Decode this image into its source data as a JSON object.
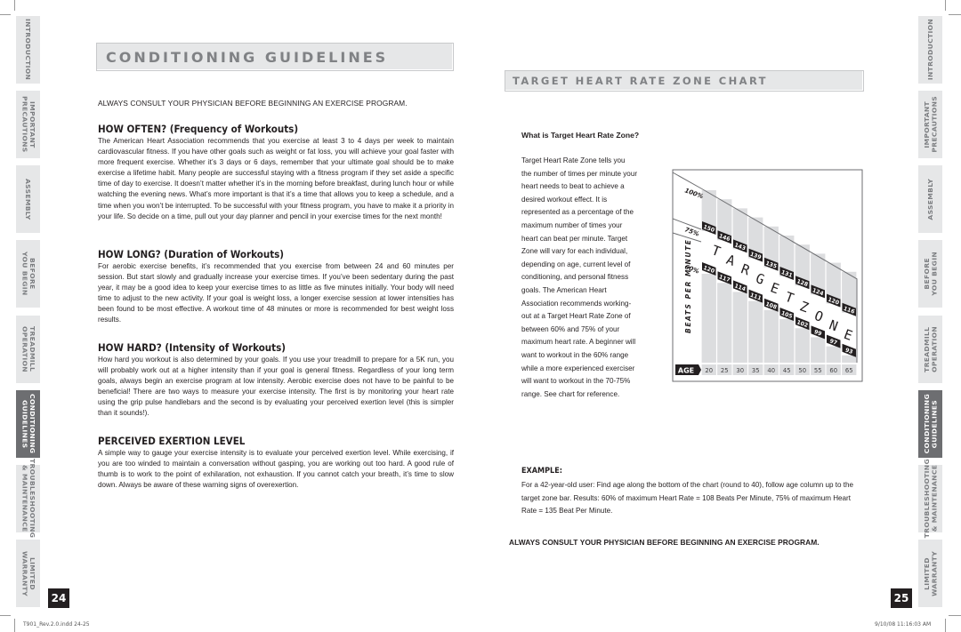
{
  "left_page": {
    "header": "CONDITIONING GUIDELINES",
    "consult_notice": "ALWAYS CONSULT YOUR PHYSICIAN BEFORE BEGINNING AN EXERCISE PROGRAM.",
    "sections": [
      {
        "title": "HOW OFTEN? (Frequency of Workouts)",
        "body": "The American Heart Association recommends that you exercise at least 3 to 4 days per week to maintain cardiovascular fitness. If you have other goals such as weight or fat loss, you will achieve your goal faster with more frequent exercise. Whether it’s 3 days or 6 days, remember that your ultimate goal should be to make exercise a lifetime habit. Many people are successful staying with a fitness program if they set aside a specific time of day to exercise. It doesn’t matter whether it’s in the morning before breakfast, during lunch hour or while watching the evening news. What’s more important is that it’s a time that allows you to keep a schedule, and a time when you won’t be interrupted. To be successful with your fitness program, you have to make it a priority in your life. So decide on a time, pull out your day planner and pencil in your exercise times for the next month!"
      },
      {
        "title": "HOW LONG? (Duration of Workouts)",
        "body": "For aerobic exercise benefits, it’s recommended that you exercise from between 24 and 60 minutes per session. But start slowly and gradually increase your exercise times. If you’ve been sedentary during the past year, it may be a good idea to keep your exercise times to as little as five minutes initially. Your body will need time to adjust to the new activity. If your goal is weight loss, a longer exercise session at lower intensities has been found to be most effective. A workout time of 48 minutes or more is recommended for best weight loss results."
      },
      {
        "title": "HOW HARD? (Intensity of Workouts)",
        "body": "How hard you workout is also determined by your goals. If you use your treadmill to prepare for a 5K run, you will probably work out at a higher intensity than if your goal is general fitness. Regardless of your long term goals, always begin an exercise program at low intensity. Aerobic exercise does not have to be painful to be beneficial! There are two ways to measure your exercise intensity. The first is by monitoring your heart rate using the grip pulse handlebars and the second is by evaluating your perceived exertion level (this is simpler than it sounds!)."
      },
      {
        "title": "PERCEIVED EXERTION LEVEL",
        "body": "A simple way to gauge your exercise intensity is to evaluate your perceived exertion level. While exercising, if you are too winded to maintain a conversation without gasping, you are working out too hard. A good rule of thumb is to work to the point of exhilaration, not exhaustion. If you cannot catch your breath, it’s time to slow down. Always be aware of these warning signs of overexertion."
      }
    ],
    "page_number": "24",
    "footer_note": "T901_Rev.2.0.indd   24-25"
  },
  "right_page": {
    "header": "TARGET HEART RATE ZONE CHART",
    "question": "What is Target Heart Rate Zone?",
    "intro": "Target Heart Rate Zone tells you the number of times per minute your heart needs to beat to achieve a desired workout effect. It is represented as a percentage of the maximum number of times your heart can beat per minute. Target Zone will vary for each individual, depending on age, current level of conditioning, and personal fitness goals. The American Heart Association recommends working-out at a Target Heart Rate Zone of between 60% and 75% of your maximum heart rate. A beginner will want to workout in the 60% range while a more experienced exerciser will want to workout in the 70-75% range. See chart for reference.",
    "example_title": "EXAMPLE:",
    "example_body": "For a 42-year-old user: Find age along the bottom of the chart (round to 40), follow age column up to the target zone bar. Results: 60% of maximum Heart Rate = 108 Beats Per Minute, 75% of maximum Heart Rate = 135 Beat Per Minute.",
    "consult_notice": "ALWAYS CONSULT YOUR PHYSICIAN BEFORE BEGINNING AN EXERCISE PROGRAM.",
    "page_number": "25",
    "footer_note": "9/10/08   11:16:03 AM"
  },
  "side_tabs": [
    {
      "label": "INTRODUCTION",
      "active": false
    },
    {
      "label": "IMPORTANT\nPRECAUTIONS",
      "active": false
    },
    {
      "label": "ASSEMBLY",
      "active": false
    },
    {
      "label": "BEFORE\nYOU BEGIN",
      "active": false
    },
    {
      "label": "TREADMILL\nOPERATION",
      "active": false
    },
    {
      "label": "CONDITIONING\nGUIDELINES",
      "active": true
    },
    {
      "label": "TROUBLESHOOTING\n& MAINTENANCE",
      "active": false
    },
    {
      "label": "LIMITED\nWARRANTY",
      "active": false
    }
  ],
  "colors": {
    "tab_bg": "#e6e7e8",
    "tab_active_bg": "#6d6e71",
    "header_text": "#808285",
    "zone_label_bg": "#231f20",
    "column_bg": "#dcdddf"
  },
  "chart_data": {
    "type": "table",
    "title": "TARGET HEART RATE ZONE CHART",
    "xlabel": "AGE",
    "ylabel": "BEATS PER MINUTE",
    "zone_label": "TARGET ZONE",
    "percent_labels": [
      "100%",
      "75%",
      "60%"
    ],
    "categories": [
      20,
      25,
      30,
      35,
      40,
      45,
      50,
      55,
      60,
      65
    ],
    "series": [
      {
        "name": "75%",
        "values": [
          150,
          146,
          143,
          139,
          135,
          131,
          128,
          124,
          120,
          116
        ]
      },
      {
        "name": "60%",
        "values": [
          120,
          117,
          114,
          111,
          108,
          105,
          102,
          99,
          97,
          93
        ]
      }
    ]
  }
}
